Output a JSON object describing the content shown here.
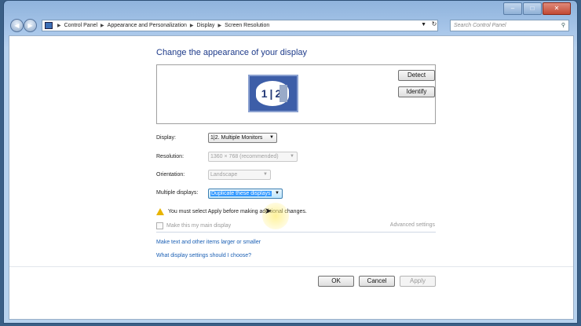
{
  "window": {
    "caption_buttons": [
      "minimize",
      "maximize",
      "close"
    ]
  },
  "address": {
    "crumbs": [
      "Control Panel",
      "Appearance and Personalization",
      "Display",
      "Screen Resolution"
    ],
    "search_placeholder": "Search Control Panel"
  },
  "content": {
    "heading": "Change the appearance of your display",
    "monitor_label": "1|2",
    "detect_label": "Detect",
    "identify_label": "Identify",
    "display": {
      "label": "Display:",
      "value": "1|2. Multiple Monitors"
    },
    "resolution": {
      "label": "Resolution:",
      "value": "1360 × 768 (recommended)"
    },
    "orientation": {
      "label": "Orientation:",
      "value": "Landscape"
    },
    "multiple_displays": {
      "label": "Multiple displays:",
      "value": "Duplicate these displays"
    },
    "warning": "You must select Apply before making additional changes.",
    "main_display_label": "Make this my main display",
    "advanced_settings": "Advanced settings",
    "link_text_size": "Make text and other items larger or smaller",
    "link_help": "What display settings should I choose?",
    "ok_label": "OK",
    "cancel_label": "Cancel",
    "apply_label": "Apply"
  },
  "colors": {
    "heading": "#1e3b8a",
    "link": "#1a5fb4",
    "warning": "#e8b400"
  }
}
